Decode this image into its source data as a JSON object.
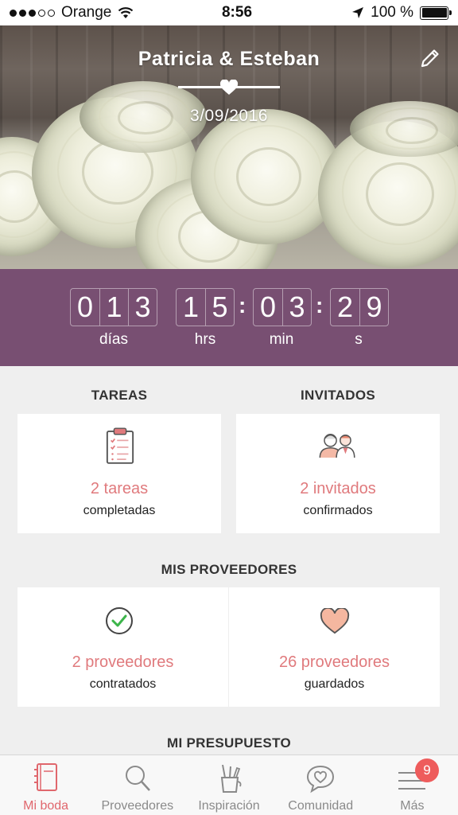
{
  "status_bar": {
    "carrier": "Orange",
    "time": "8:56",
    "battery": "100 %"
  },
  "header": {
    "couple_names": "Patricia & Esteban",
    "wedding_date": "3/09/2016"
  },
  "countdown": {
    "days": [
      "0",
      "1",
      "3"
    ],
    "hours": [
      "1",
      "5"
    ],
    "minutes": [
      "0",
      "3"
    ],
    "seconds": [
      "2",
      "9"
    ],
    "labels": {
      "days": "días",
      "hours": "hrs",
      "minutes": "min",
      "seconds": "s"
    }
  },
  "tasks": {
    "title": "TAREAS",
    "count": "2 tareas",
    "status": "completadas"
  },
  "guests": {
    "title": "INVITADOS",
    "count": "2 invitados",
    "status": "confirmados"
  },
  "vendors": {
    "title": "MIS PROVEEDORES",
    "hired": {
      "count": "2 proveedores",
      "status": "contratados"
    },
    "saved": {
      "count": "26 proveedores",
      "status": "guardados"
    }
  },
  "budget": {
    "title": "MI PRESUPUESTO"
  },
  "tab_bar": {
    "items": [
      {
        "label": "Mi boda",
        "icon": "notebook-icon",
        "active": true
      },
      {
        "label": "Proveedores",
        "icon": "search-icon"
      },
      {
        "label": "Inspiración",
        "icon": "pencil-cup-icon"
      },
      {
        "label": "Comunidad",
        "icon": "chat-heart-icon"
      },
      {
        "label": "Más",
        "icon": "menu-icon",
        "badge": "9"
      }
    ]
  },
  "colors": {
    "accent": "#e07a7d",
    "countdown_bg": "#784f72",
    "badge": "#ee5c5c"
  }
}
